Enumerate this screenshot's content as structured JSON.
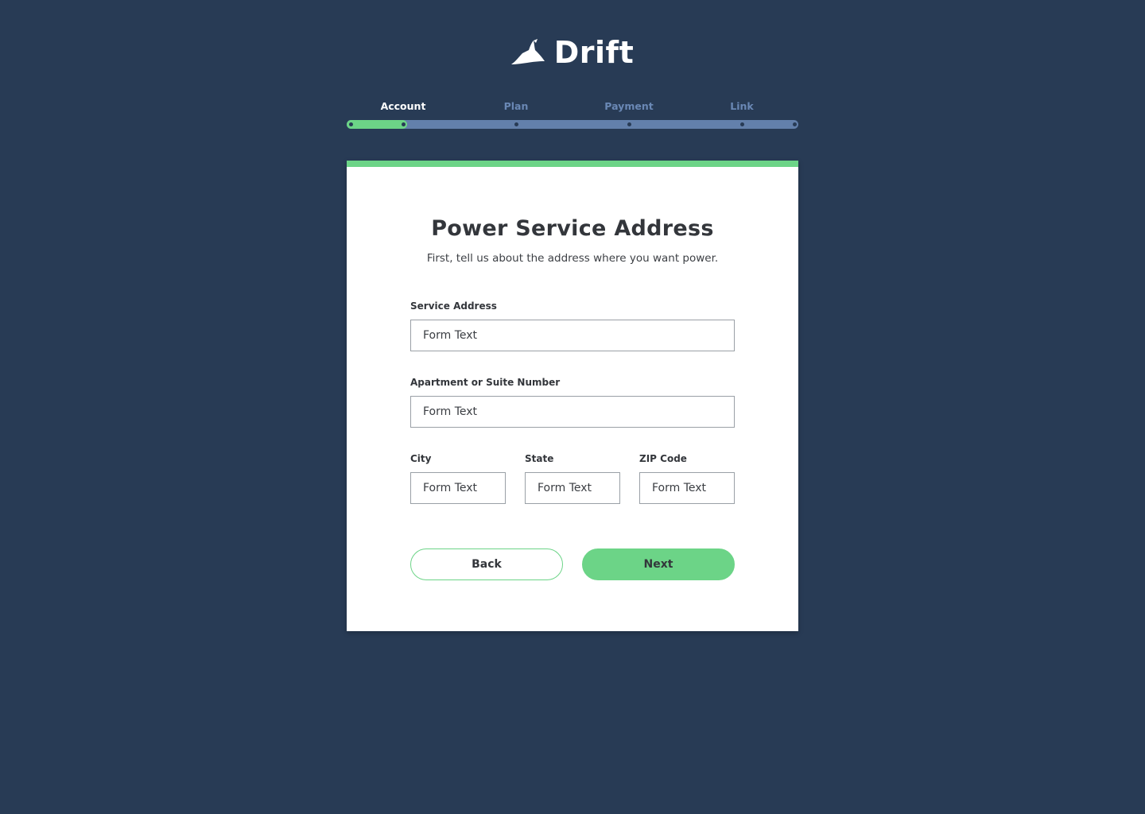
{
  "brand": {
    "name": "Drift",
    "logo_icon": "bird-icon"
  },
  "stepper": {
    "steps": [
      {
        "label": "Account",
        "active": true
      },
      {
        "label": "Plan",
        "active": false
      },
      {
        "label": "Payment",
        "active": false
      },
      {
        "label": "Link",
        "active": false
      }
    ],
    "progress_fraction": 0.125
  },
  "form": {
    "title": "Power Service Address",
    "subtitle": "First, tell us about the address where you want power.",
    "fields": {
      "service_address": {
        "label": "Service Address",
        "placeholder": "Form Text"
      },
      "apartment": {
        "label": "Apartment or Suite Number",
        "placeholder": "Form Text"
      },
      "city": {
        "label": "City",
        "placeholder": "Form Text"
      },
      "state": {
        "label": "State",
        "placeholder": "Form Text"
      },
      "zip": {
        "label": "ZIP Code",
        "placeholder": "Form Text"
      }
    },
    "back_label": "Back",
    "next_label": "Next"
  },
  "colors": {
    "background": "#283b55",
    "accent": "#6cd487",
    "track": "#6380ab",
    "inactive_step": "#6a88b5",
    "text_dark": "#33363b"
  }
}
